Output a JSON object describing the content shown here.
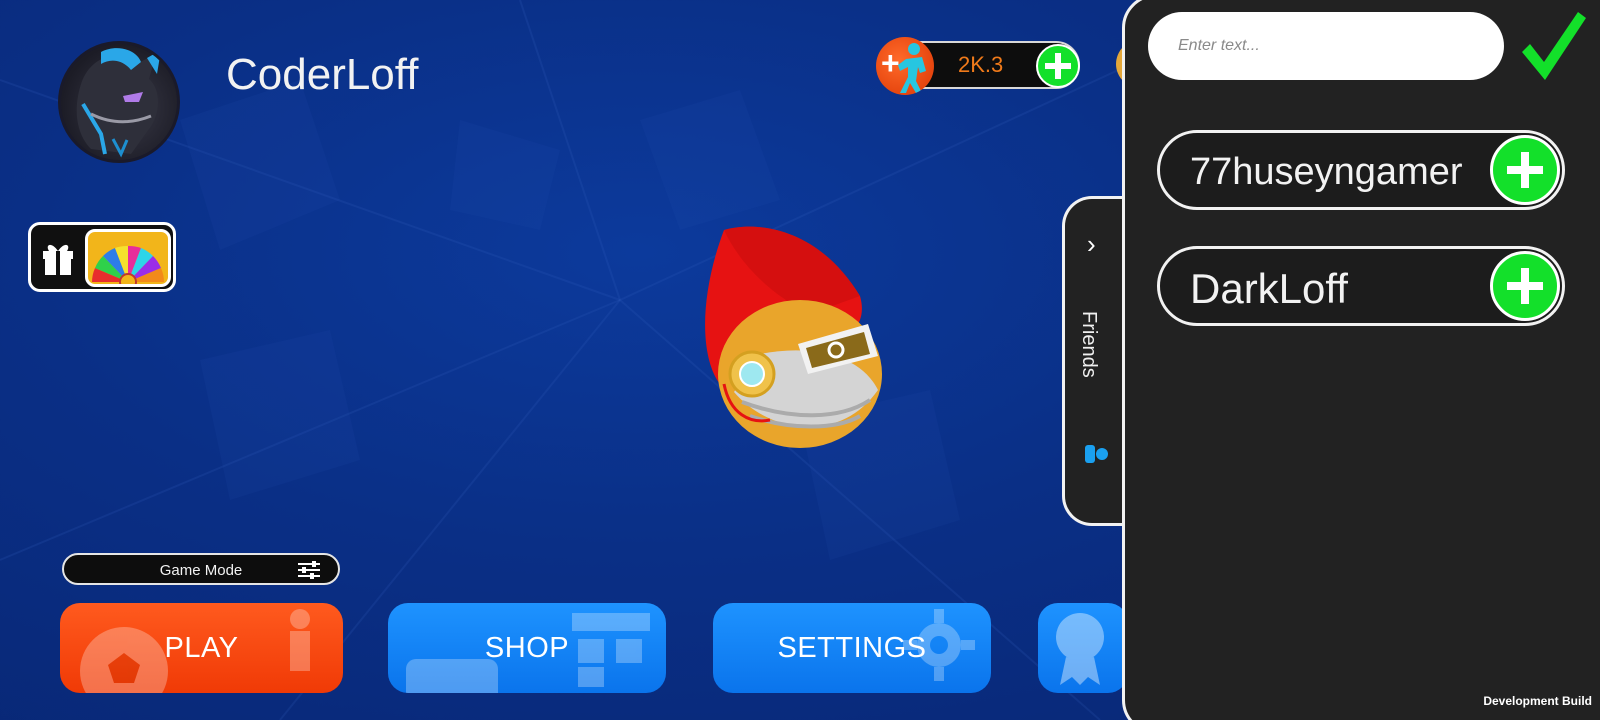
{
  "player": {
    "name": "CoderLoff",
    "avatar_icon": "dragon-avatar"
  },
  "currency": {
    "value": "2K.3",
    "plus_left": "+",
    "figure_icon": "dancing-figure-icon",
    "add_icon": "plus-icon",
    "value_color": "#f07a1a"
  },
  "rewards": {
    "gift_icon": "gift-icon",
    "wheel_icon": "prize-wheel-icon"
  },
  "character": {
    "icon": "egg-character-with-red-flame-hair"
  },
  "game_mode": {
    "label": "Game Mode",
    "icon": "sliders-icon"
  },
  "buttons": {
    "play": "PLAY",
    "shop": "SHOP",
    "settings": "SETTINGS",
    "extra_icon": "medal-icon"
  },
  "friends": {
    "tab_label": "Friends",
    "chevron_icon": "chevron-right-icon",
    "person_icon": "person-icon",
    "search_placeholder": "Enter text...",
    "confirm_icon": "checkmark-icon",
    "list": [
      {
        "name": "77huseyngamer",
        "add_icon": "plus-icon"
      },
      {
        "name": "DarkLoff",
        "add_icon": "plus-icon"
      }
    ]
  },
  "colors": {
    "background": "#0a2f86",
    "play": "#f5460a",
    "blue_button": "#1283f5",
    "add_green": "#13e02a",
    "panel": "#222222"
  },
  "footer": {
    "build": "Development Build"
  }
}
